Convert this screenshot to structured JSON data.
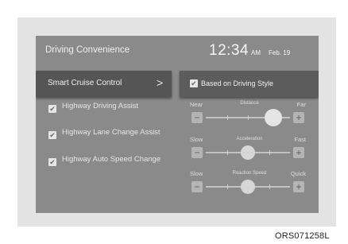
{
  "header": {
    "title": "Driving Convenience",
    "time": "12:34",
    "ampm": "AM",
    "date": "Feb. 19"
  },
  "menu": {
    "selected_item": "Smart Cruise Control",
    "chevron": ">"
  },
  "style_option": {
    "label": "Based on Driving Style",
    "checked": true
  },
  "options": [
    {
      "label": "Highway Driving Assist",
      "checked": true
    },
    {
      "label": "Highway Lane Change Assist",
      "checked": true
    },
    {
      "label": "Highway Auto Speed Change",
      "checked": true
    }
  ],
  "sliders": [
    {
      "left_label": "Near",
      "center_label": "Distance",
      "right_label": "Far",
      "value": 0.8
    },
    {
      "left_label": "Slow",
      "center_label": "Acceleration",
      "right_label": "Fast",
      "value": 0.5
    },
    {
      "left_label": "Slow",
      "center_label": "Reaction Speed",
      "right_label": "Quick",
      "value": 0.5
    }
  ],
  "controls": {
    "minus": "−",
    "plus": "+",
    "check": "✔"
  },
  "figure_code": "ORS071258L",
  "colors": {
    "screen_bg": "#8a8a8a",
    "panel_bg": "#e3e3e3",
    "selected_item_bg": "#555555"
  }
}
